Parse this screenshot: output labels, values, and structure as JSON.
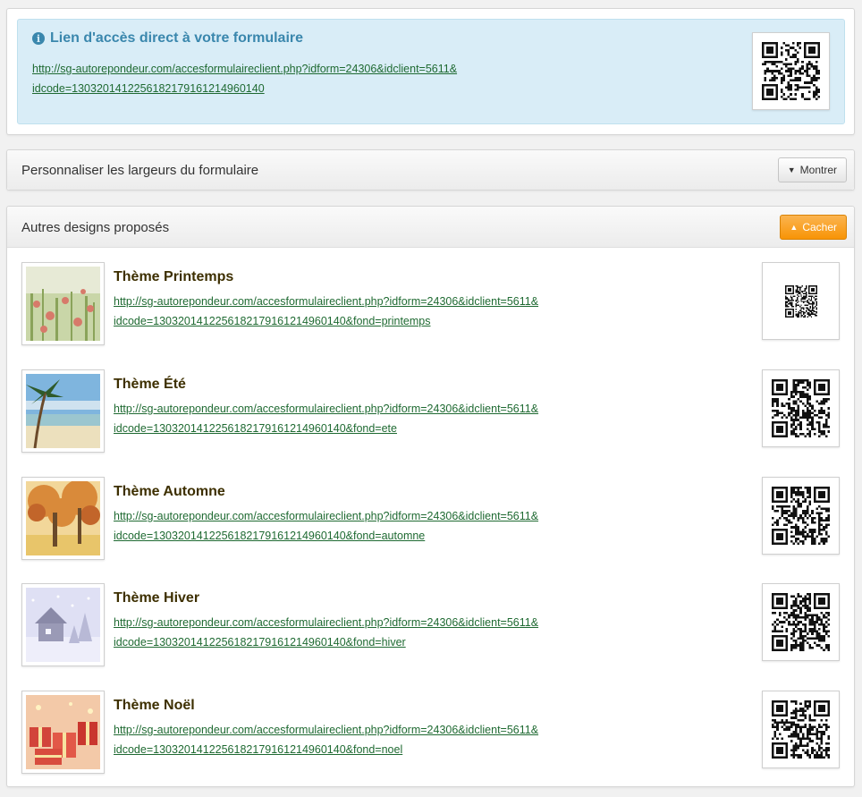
{
  "direct": {
    "title": "Lien d'accès direct à votre formulaire",
    "link_line1": "http://sg-autorepondeur.com/accesformulaireclient.php?idform=24306&idclient=5611&",
    "link_line2": "idcode=1303201412256182179161214960140"
  },
  "widths": {
    "title": "Personnaliser les largeurs du formulaire",
    "button_label": "Montrer"
  },
  "designs": {
    "title": "Autres designs proposés",
    "button_label": "Cacher",
    "themes": [
      {
        "name": "Thème Printemps",
        "link_line1": "http://sg-autorepondeur.com/accesformulaireclient.php?idform=24306&idclient=5611&",
        "link_line2": "idcode=1303201412256182179161214960140&fond=printemps"
      },
      {
        "name": "Thème Été",
        "link_line1": "http://sg-autorepondeur.com/accesformulaireclient.php?idform=24306&idclient=5611&",
        "link_line2": "idcode=1303201412256182179161214960140&fond=ete"
      },
      {
        "name": "Thème Automne",
        "link_line1": "http://sg-autorepondeur.com/accesformulaireclient.php?idform=24306&idclient=5611&",
        "link_line2": "idcode=1303201412256182179161214960140&fond=automne"
      },
      {
        "name": "Thème Hiver",
        "link_line1": "http://sg-autorepondeur.com/accesformulaireclient.php?idform=24306&idclient=5611&",
        "link_line2": "idcode=1303201412256182179161214960140&fond=hiver"
      },
      {
        "name": "Thème Noël",
        "link_line1": "http://sg-autorepondeur.com/accesformulaireclient.php?idform=24306&idclient=5611&",
        "link_line2": "idcode=1303201412256182179161214960140&fond=noel"
      }
    ]
  },
  "icons": {
    "info": "info-circle-icon",
    "caret_down": "caret-down-icon",
    "caret_up": "caret-up-icon",
    "qr": "qr-code-icon"
  },
  "colors": {
    "info_bg": "#d9edf7",
    "info_text": "#3a87ad",
    "link": "#1f6a32",
    "theme_title": "#3d2f00",
    "warning_button": "#f89406"
  }
}
